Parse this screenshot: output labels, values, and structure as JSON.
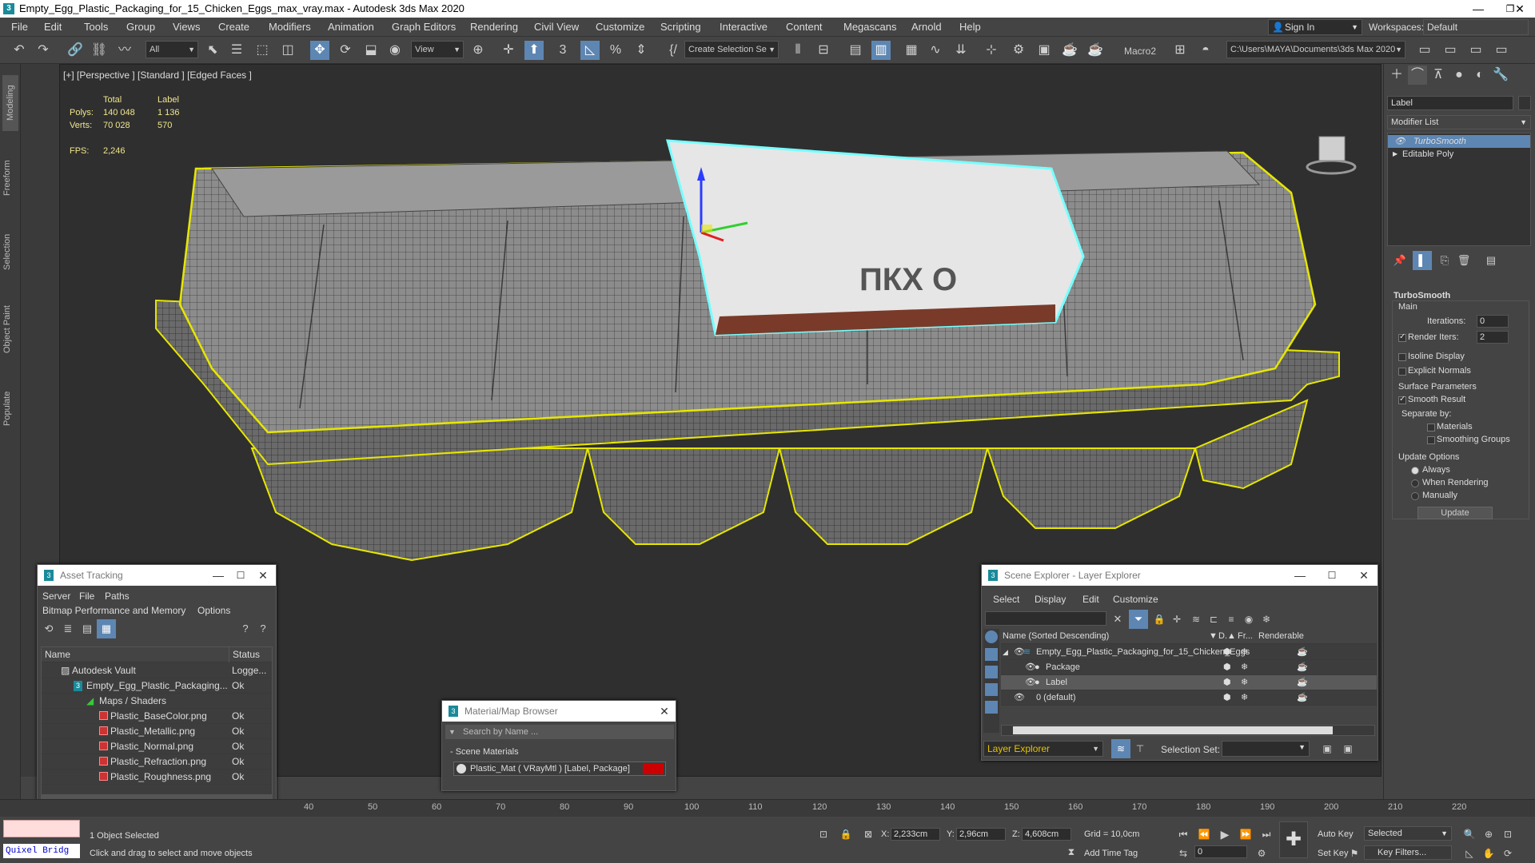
{
  "window": {
    "title": "Empty_Egg_Plastic_Packaging_for_15_Chicken_Eggs_max_vray.max - Autodesk 3ds Max 2020",
    "minimize": "—",
    "restore": "❐",
    "close": "✕"
  },
  "menu": [
    "File",
    "Edit",
    "Tools",
    "Group",
    "Views",
    "Create",
    "Modifiers",
    "Animation",
    "Graph Editors",
    "Rendering",
    "Civil View",
    "Customize",
    "Scripting",
    "Interactive",
    "Content",
    "Megascans",
    "Arnold",
    "Help"
  ],
  "account": {
    "sign_in": "Sign In",
    "workspaces_label": "Workspaces:",
    "workspace": "Default"
  },
  "toolbar": {
    "filter": "All",
    "ref_coord": "View",
    "selection_set": "Create Selection Se",
    "macro": "Macro2",
    "project_path": "C:\\Users\\MAYA\\Documents\\3ds Max 2020"
  },
  "left_tabs": [
    "Modeling",
    "Freeform",
    "Selection",
    "Object Paint",
    "Populate"
  ],
  "viewport": {
    "label": "[+] [Perspective ] [Standard ] [Edged Faces ]",
    "stats": {
      "h_total": "Total",
      "h_label": "Label",
      "polys_label": "Polys:",
      "polys_total": "140 048",
      "polys_sel": "1 136",
      "verts_label": "Verts:",
      "verts_total": "70 028",
      "verts_sel": "570",
      "fps_label": "FPS:",
      "fps": "2,246"
    },
    "label_text": "ПКХ О"
  },
  "command_panel": {
    "object_name": "Label",
    "modifier_list": "Modifier List",
    "stack": [
      "TurboSmooth",
      "Editable Poly"
    ],
    "turbosmooth": {
      "title": "TurboSmooth",
      "main": "Main",
      "iterations_label": "Iterations:",
      "iterations": "0",
      "render_iters_label": "Render Iters:",
      "render_iters": "2",
      "isoline": "Isoline Display",
      "explicit": "Explicit Normals",
      "surface": "Surface Parameters",
      "smooth_result": "Smooth Result",
      "separate_by": "Separate by:",
      "materials": "Materials",
      "smoothing_groups": "Smoothing Groups",
      "update_options": "Update Options",
      "always": "Always",
      "when_rendering": "When Rendering",
      "manually": "Manually",
      "update_btn": "Update"
    }
  },
  "asset_tracking": {
    "title": "Asset Tracking",
    "menu": [
      "Server",
      "File",
      "Paths"
    ],
    "menu2": [
      "Bitmap Performance and Memory",
      "Options"
    ],
    "col_name": "Name",
    "col_status": "Status",
    "rows": [
      {
        "name": "Autodesk Vault",
        "status": "Logge...",
        "indent": 1
      },
      {
        "name": "Empty_Egg_Plastic_Packaging...",
        "status": "Ok",
        "indent": 2
      },
      {
        "name": "Maps / Shaders",
        "status": "",
        "indent": 3
      },
      {
        "name": "Plastic_BaseColor.png",
        "status": "Ok",
        "indent": 4
      },
      {
        "name": "Plastic_Metallic.png",
        "status": "Ok",
        "indent": 4
      },
      {
        "name": "Plastic_Normal.png",
        "status": "Ok",
        "indent": 4
      },
      {
        "name": "Plastic_Refraction.png",
        "status": "Ok",
        "indent": 4
      },
      {
        "name": "Plastic_Roughness.png",
        "status": "Ok",
        "indent": 4
      }
    ]
  },
  "material_browser": {
    "title": "Material/Map Browser",
    "search": "Search by Name ...",
    "group": "- Scene Materials",
    "item": "Plastic_Mat  ( VRayMtl )  [Label, Package]"
  },
  "scene_explorer": {
    "title": "Scene Explorer - Layer Explorer",
    "menu": [
      "Select",
      "Display",
      "Edit",
      "Customize"
    ],
    "col_name": "Name (Sorted Descending)",
    "col_d": "D.▲",
    "col_fr": "Fr...",
    "col_render": "Renderable",
    "rows": [
      {
        "name": "Empty_Egg_Plastic_Packaging_for_15_Chicken_Eggs",
        "level": 0
      },
      {
        "name": "Package",
        "level": 1
      },
      {
        "name": "Label",
        "level": 1
      },
      {
        "name": "0 (default)",
        "level": 0
      }
    ],
    "layer_explorer": "Layer Explorer",
    "selection_set": "Selection Set:"
  },
  "timeline": {
    "ticks": [
      "40",
      "50",
      "60",
      "70",
      "80",
      "90",
      "100",
      "110",
      "120",
      "130",
      "140",
      "150",
      "160",
      "170",
      "180",
      "190",
      "200",
      "210",
      "220"
    ]
  },
  "status": {
    "quixel": "Quixel Bridg",
    "selected": "1 Object Selected",
    "prompt": "Click and drag to select and move objects",
    "x_label": "X:",
    "x": "2,233cm",
    "y_label": "Y:",
    "y": "2,96cm",
    "z_label": "Z:",
    "z": "4,608cm",
    "grid": "Grid = 10,0cm",
    "add_time_tag": "Add Time Tag",
    "auto_key": "Auto Key",
    "set_key": "Set Key",
    "selected_dd": "Selected",
    "key_filters": "Key Filters...",
    "frame": "0"
  },
  "colors": {
    "selection_outline": "#e6e600",
    "label_outline": "#7ff",
    "accent": "#5d86b3"
  }
}
